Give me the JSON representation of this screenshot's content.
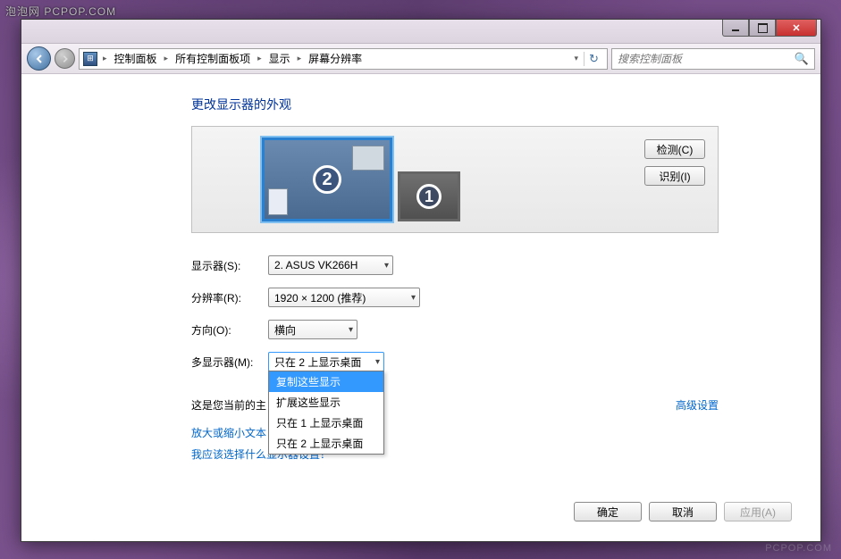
{
  "watermark": {
    "top": "泡泡网  PCPOP.COM",
    "bottom": "PCPOP.COM"
  },
  "breadcrumbs": [
    "控制面板",
    "所有控制面板项",
    "显示",
    "屏幕分辨率"
  ],
  "search": {
    "placeholder": "搜索控制面板"
  },
  "heading": "更改显示器的外观",
  "side_buttons": {
    "detect": "检测(C)",
    "identify": "识别(I)"
  },
  "monitors": [
    {
      "num": "2",
      "selected": true
    },
    {
      "num": "1",
      "selected": false
    }
  ],
  "form": {
    "display_label": "显示器(S):",
    "display_value": "2. ASUS VK266H",
    "resolution_label": "分辨率(R):",
    "resolution_value": "1920 × 1200 (推荐)",
    "orientation_label": "方向(O):",
    "orientation_value": "横向",
    "multi_label": "多显示器(M):",
    "multi_value": "只在 2 上显示桌面",
    "multi_options": [
      "复制这些显示",
      "扩展这些显示",
      "只在 1 上显示桌面",
      "只在 2 上显示桌面"
    ],
    "multi_highlight_index": 0
  },
  "note": "这是您当前的主",
  "advanced_link": "高级设置",
  "links": {
    "resize": "放大或缩小文本",
    "which": "我应该选择什么显示器设置？"
  },
  "footer": {
    "ok": "确定",
    "cancel": "取消",
    "apply": "应用(A)"
  }
}
